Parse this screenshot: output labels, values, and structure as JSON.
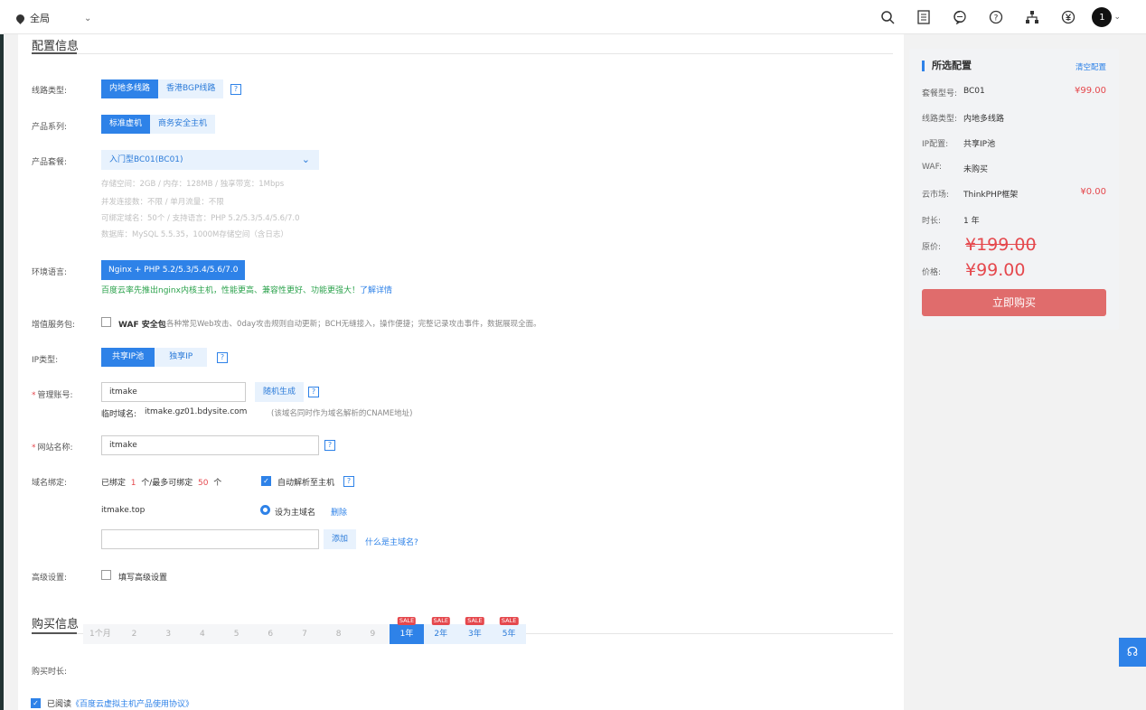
{
  "topbar": {
    "region": "全局",
    "avatar": "1"
  },
  "config": {
    "section_title": "配置信息",
    "line_type": {
      "label": "线路类型:",
      "options": [
        "内地多线路",
        "香港BGP线路"
      ]
    },
    "series": {
      "label": "产品系列:",
      "options": [
        "标准虚机",
        "商务安全主机"
      ]
    },
    "package": {
      "label": "产品套餐:",
      "value": "入门型BC01(BC01)",
      "specs": [
        "存储空间：2GB / 内存：128MB / 独享带宽：1Mbps",
        "并发连接数：不限 / 单月流量：不限",
        "可绑定域名：50个 / 支持语言：PHP 5.2/5.3/5.4/5.6/7.0",
        "数据库：MySQL 5.5.35，1000M存储空间（含日志）"
      ]
    },
    "env": {
      "label": "环境语言:",
      "value": "Nginx + PHP 5.2/5.3/5.4/5.6/7.0",
      "note": "百度云率先推出nginx内核主机，性能更高、兼容性更好、功能更强大！",
      "note_link": "了解详情"
    },
    "addon": {
      "label": "增值服务包:",
      "name": "WAF 安全包",
      "desc": "各种常见Web攻击、0day攻击规则自动更新；BCH无缝接入，操作便捷；完整记录攻击事件，数据展现全面。"
    },
    "ip": {
      "label": "IP类型:",
      "options": [
        "共享IP池",
        "独享IP"
      ]
    },
    "account": {
      "label": "管理账号:",
      "value": "itmake",
      "random": "随机生成",
      "temp_label": "临时域名:",
      "temp_domain": "itmake.gz01.bdysite.com",
      "temp_note": "(该域名同时作为域名解析的CNAME地址)"
    },
    "site": {
      "label": "网站名称:",
      "value": "itmake"
    },
    "domain": {
      "label": "域名绑定:",
      "bound_prefix": "已绑定",
      "bound": "1",
      "bound_mid": "个/最多可绑定",
      "max": "50",
      "bound_suffix": "个",
      "auto": "自动解析至主机",
      "item": "itmake.top",
      "main": "设为主域名",
      "delete": "删除",
      "add": "添加",
      "what": "什么是主域名?"
    },
    "advanced": {
      "label": "高级设置:",
      "option": "填写高级设置"
    }
  },
  "purchase": {
    "section_title": "购买信息",
    "label": "购买时长:",
    "months": [
      "1个月",
      "2",
      "3",
      "4",
      "5",
      "6",
      "7",
      "8",
      "9"
    ],
    "years": [
      "1年",
      "2年",
      "3年",
      "5年"
    ],
    "sale": "SALE",
    "agree_prefix": "已阅读",
    "agree_link": "《百度云虚拟主机产品使用协议》"
  },
  "summary": {
    "title": "所选配置",
    "clear": "清空配置",
    "rows": [
      {
        "k": "套餐型号:",
        "v": "BC01",
        "p": "¥99.00"
      },
      {
        "k": "线路类型:",
        "v": "内地多线路",
        "p": ""
      },
      {
        "k": "IP配置:",
        "v": "共享IP池",
        "p": ""
      },
      {
        "k": "WAF:",
        "v": "未购买",
        "p": ""
      },
      {
        "k": "云市场:",
        "v": "ThinkPHP框架",
        "p": "¥0.00"
      },
      {
        "k": "时长:",
        "v": "1 年",
        "p": ""
      }
    ],
    "orig_label": "原价:",
    "orig": "¥199.00",
    "price_label": "价格:",
    "price": "¥99.00",
    "buy": "立即购买"
  },
  "colors": {
    "accent": "#2e82e8",
    "price": "#e5484d",
    "buy": "#e06c6c",
    "note": "#2ba24c"
  }
}
